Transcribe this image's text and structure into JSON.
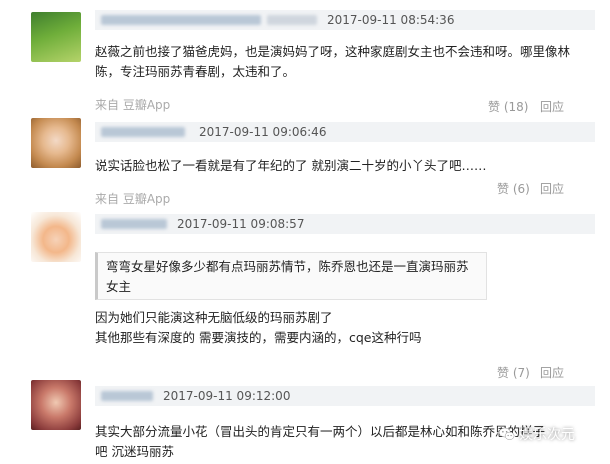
{
  "colors": {
    "header_bg": "#f1f3f5",
    "muted": "#999999",
    "source": "#aaaaaa"
  },
  "comments": [
    {
      "timestamp": "2017-09-11 08:54:36",
      "text": "赵薇之前也接了猫爸虎妈，也是演妈妈了呀，这种家庭剧女主也不会违和呀。哪里像林陈，专注玛丽苏青春剧，太违和了。",
      "source": "来自 豆瓣App",
      "likes": "赞 (18)",
      "reply": "回应"
    },
    {
      "timestamp": "2017-09-11 09:06:46",
      "text": "说实话脸也松了一看就是有了年纪的了 就别演二十岁的小丫头了吧……",
      "source": "来自 豆瓣App",
      "likes": "赞 (6)",
      "reply": "回应"
    },
    {
      "timestamp": "2017-09-11 09:08:57",
      "quote": "弯弯女星好像多少都有点玛丽苏情节，陈乔恩也还是一直演玛丽苏女主",
      "text": "因为她们只能演这种无脑低级的玛丽苏剧了\n其他那些有深度的 需要演技的，需要内涵的，cqe这种行吗",
      "likes": "赞 (7)",
      "reply": "回应"
    },
    {
      "timestamp": "2017-09-11 09:12:00",
      "text": "其实大部分流量小花（冒出头的肯定只有一两个）以后都是林心如和陈乔恩的样子吧 沉迷玛丽苏"
    }
  ],
  "watermark": {
    "text": "娱乐次元",
    "icon": "wechat-icon"
  }
}
